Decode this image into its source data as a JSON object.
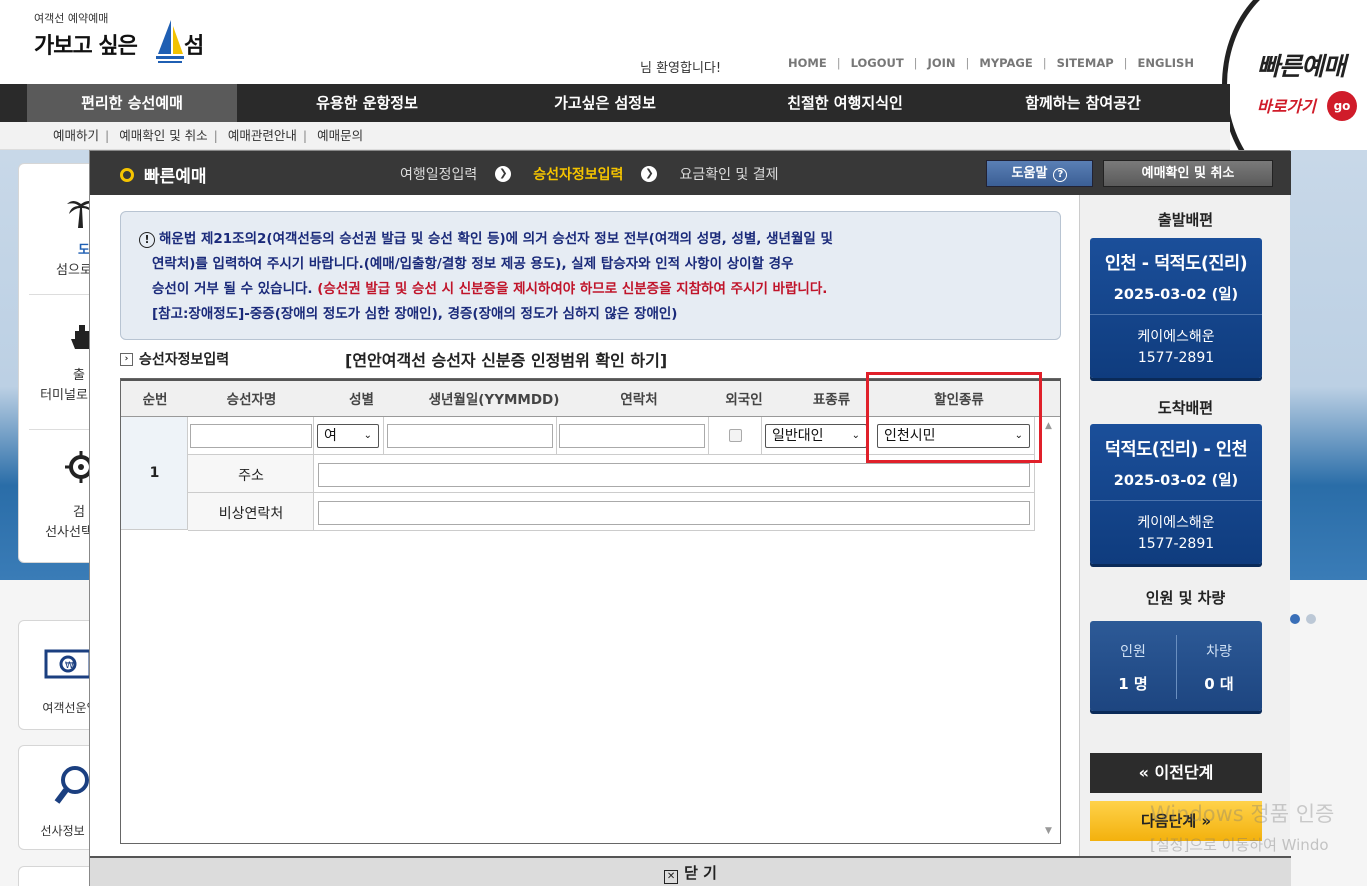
{
  "header": {
    "logo_small": "여객선 예약예매",
    "logo_big": "가보고 싶은",
    "logo_big2": "섬",
    "welcome": "님 환영합니다!",
    "links": [
      "HOME",
      "LOGOUT",
      "JOIN",
      "MYPAGE",
      "SITEMAP",
      "ENGLISH"
    ],
    "quick_title": "빠른예매",
    "quick_sub": "바로가기",
    "quick_go": "go"
  },
  "gnb": [
    "편리한 승선예매",
    "유용한 운항정보",
    "가고싶은 섬정보",
    "친절한 여행지식인",
    "함께하는 참여공간"
  ],
  "subnav": [
    "예매하기",
    "예매확인 및 취소",
    "예매관련안내",
    "예매문의"
  ],
  "leftcards": {
    "c1": [
      "도",
      "섬으로"
    ],
    "c2": [
      "출",
      "터미널로"
    ],
    "c3": [
      "검",
      "선사선택"
    ],
    "c4": "여객선운임",
    "c5": "선사정보 조"
  },
  "modal": {
    "title": "빠른예매",
    "steps": [
      "여행일정입력",
      "승선자정보입력",
      "요금확인 및 결제"
    ],
    "help": "도움말",
    "help_q": "?",
    "cancel": "예매확인 및 취소",
    "notice": {
      "warn": "!",
      "line1": "해운법 제21조의2(여객선등의 승선권 발급 및 승선 확인 등)에 의거 승선자 정보 전부(여객의 성명, 성별, 생년월일 및",
      "line2": "연락처)를 입력하여 주시기 바랍니다.(예매/입출항/결항 정보 제공 용도), 실제 탑승자와 인적 사항이 상이할 경우",
      "line3a": "승선이 거부 될 수 있습니다. ",
      "line3b": "(승선권 발급 및 승선 시 신분증을 제시하여야 하므로 신분증을 지참하여 주시기 바랍니다.",
      "line4": "[참고:장애정도]-중증(장애의 정도가 심한 장애인), 경증(장애의 정도가 심하지 않은 장애인)"
    },
    "section_title": "승선자정보입력",
    "id_link": "[연안여객선 승선자 신분증 인정범위 확인 하기]",
    "table": {
      "headers": [
        "순번",
        "승선자명",
        "성별",
        "생년월일(YYMMDD)",
        "연락처",
        "외국인",
        "표종류",
        "할인종류"
      ],
      "row_no": "1",
      "gender": "여",
      "ticket_type": "일반대인",
      "discount_type": "인천시민",
      "addr_label": "주소",
      "emerg_label": "비상연락처"
    },
    "side": {
      "dep_header": "출발배편",
      "dep_route": "인천 - 덕적도(진리)",
      "dep_date": "2025-03-02 (일)",
      "dep_company": "케이에스해운",
      "dep_tel": "1577-2891",
      "arr_header": "도착배편",
      "arr_route": "덕적도(진리) - 인천",
      "arr_date": "2025-03-02 (일)",
      "arr_company": "케이에스해운",
      "arr_tel": "1577-2891",
      "count_header": "인원 및 차량",
      "people_label": "인원",
      "people_value": "1 명",
      "car_label": "차량",
      "car_value": "0 대",
      "prev": "« 이전단계",
      "next": "다음단계 »"
    },
    "close": "닫 기",
    "close_x": "✕"
  },
  "watermark": [
    "Windows 정품 인증",
    "[설정]으로 이동하여 Windo"
  ],
  "colors": {
    "accent_blue": "#1b4f9a",
    "highlight_red": "#e0202a",
    "step_active": "#f5c400"
  }
}
